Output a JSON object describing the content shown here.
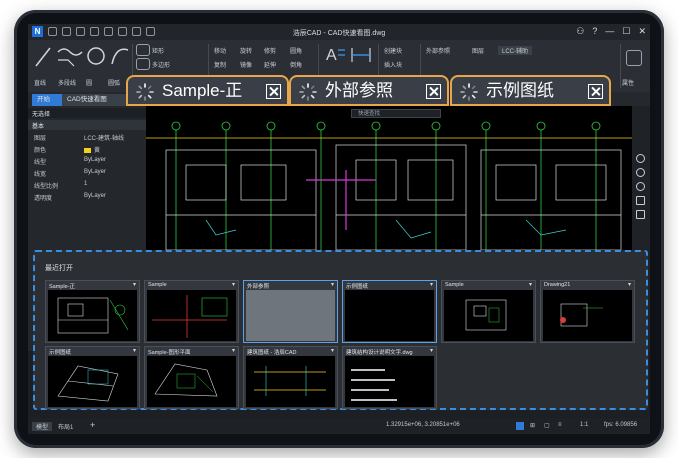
{
  "window": {
    "title": "浩辰CAD - CAD快速看图.dwg",
    "controls": [
      "⚇",
      "?",
      "—",
      "☐",
      "✕"
    ]
  },
  "ribbon": {
    "groups": [
      "直线",
      "多段线",
      "圆",
      "圆弧",
      "矩形",
      "多边形",
      "移动",
      "旋转",
      "复制",
      "镜像",
      "修剪",
      "延伸",
      "圆角",
      "倒角",
      "文字",
      "标注",
      "创建块",
      "插入块",
      "外部参照",
      "图层",
      "LCC-辅助",
      "属性"
    ],
    "labels_row": [
      "直线",
      "多段线",
      "圆",
      "圆弧"
    ]
  },
  "doc_tabs": {
    "start": "开始",
    "active": "CAD快速看图"
  },
  "properties": {
    "selector": "无选择",
    "section": "基本",
    "rows": [
      {
        "k": "图层",
        "v": "LCC-建筑-轴线"
      },
      {
        "k": "颜色",
        "v": "黄"
      },
      {
        "k": "线型",
        "v": "ByLayer"
      },
      {
        "k": "线宽",
        "v": "ByLayer"
      },
      {
        "k": "线型比例",
        "v": "1"
      },
      {
        "k": "透明度",
        "v": "ByLayer"
      }
    ]
  },
  "canvas": {
    "search_placeholder": "快速查找"
  },
  "floating_tabs": [
    {
      "label": "Sample-正"
    },
    {
      "label": "外部参照"
    },
    {
      "label": "示例图纸"
    }
  ],
  "recent": {
    "title": "最近打开",
    "cards": [
      {
        "name": "Sample-正"
      },
      {
        "name": "Sample"
      },
      {
        "name": "外部参照"
      },
      {
        "name": "示例图纸"
      },
      {
        "name": "Sample"
      },
      {
        "name": "Drawing21"
      },
      {
        "name": "示例图纸"
      },
      {
        "name": "Sample-图形平面"
      },
      {
        "name": "建筑图纸 - 浩辰CAD"
      },
      {
        "name": "建筑结构设计说明文字.dwg"
      }
    ]
  },
  "statusbar": {
    "model_tab": "模型",
    "layout_tab": "布局1",
    "add": "+",
    "coords": "1.32915e+06, 3.20851e+06",
    "scale": "1:1",
    "fps": "fps: 6.09856"
  },
  "colors": {
    "accent": "#2f7bd6",
    "tab_border": "#e7a64a",
    "panel_border": "#3b8de0"
  }
}
